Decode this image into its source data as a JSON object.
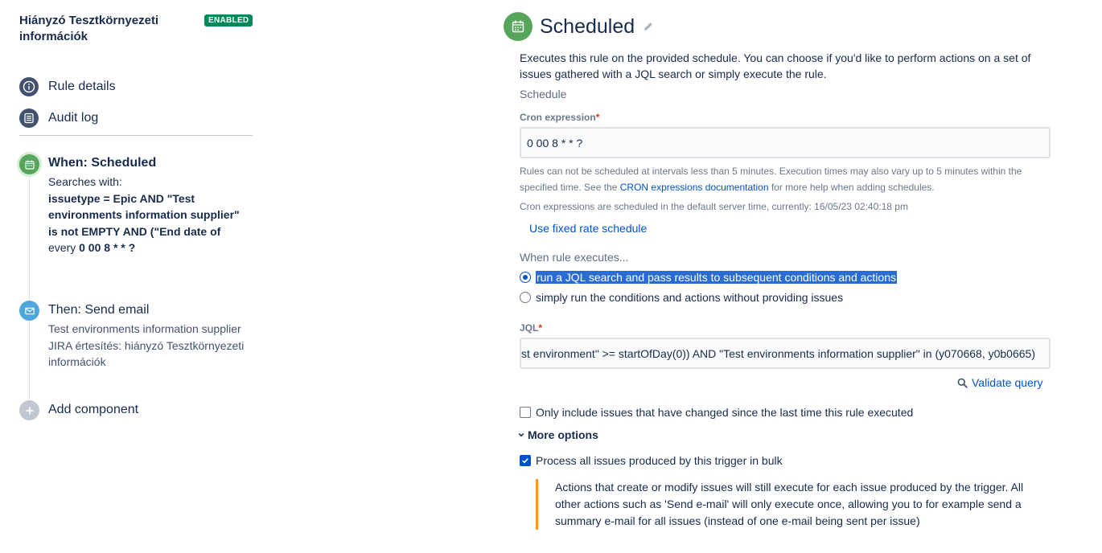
{
  "sidebar": {
    "rule_title": "Hiányzó Tesztkörnyezeti információk",
    "status_badge": "ENABLED",
    "nav": [
      {
        "label": "Rule details",
        "icon": "info-icon"
      },
      {
        "label": "Audit log",
        "icon": "list-icon"
      }
    ],
    "trigger": {
      "title": "When: Scheduled",
      "subtitle": "Searches with:",
      "jql_lines": [
        "issuetype = Epic AND \"Test",
        "environments information supplier\"",
        "is not EMPTY AND (\"End date of"
      ],
      "every_prefix": "every",
      "every_value": "0 00 8 * * ?",
      "icon": "calendar-icon"
    },
    "action": {
      "title": "Then: Send email",
      "lines": [
        "Test environments information supplier",
        "JIRA értesítés: hiányzó Tesztkörnyezeti",
        "információk"
      ],
      "icon": "mail-icon"
    },
    "add_component": {
      "label": "Add component",
      "icon": "plus-icon"
    }
  },
  "main": {
    "title": "Scheduled",
    "description": "Executes this rule on the provided schedule. You can choose if you'd like to perform actions on a set of issues gathered with a JQL search or simply execute the rule.",
    "schedule_label": "Schedule",
    "cron": {
      "label": "Cron expression",
      "required_mark": "*",
      "value": "0 00 8 * * ?",
      "help_part1": "Rules can not be scheduled at intervals less than 5 minutes. Execution times may also vary up to 5 minutes within the specified time. See the ",
      "help_link": "CRON expressions documentation",
      "help_part2": " for more help when adding schedules.",
      "server_time_note": "Cron expressions are scheduled in the default server time, currently: 16/05/23 02:40:18 pm"
    },
    "fixed_rate_link": "Use fixed rate schedule",
    "when_executes_label": "When rule executes...",
    "radio_options": [
      {
        "label": "run a JQL search and pass results to subsequent conditions and actions",
        "checked": true
      },
      {
        "label": "simply run the conditions and actions without providing issues",
        "checked": false
      }
    ],
    "jql": {
      "label": "JQL",
      "required_mark": "*",
      "value": "st environment\" >= startOfDay(0)) AND \"Test environments information supplier\" in (y070668, y0b0665)"
    },
    "validate_link": "Validate query",
    "only_changed": {
      "label": "Only include issues that have changed since the last time this rule executed",
      "checked": false
    },
    "more_options_label": "More options",
    "bulk": {
      "label": "Process all issues produced by this trigger in bulk",
      "checked": true
    },
    "bulk_info": "Actions that create or modify issues will still execute for each issue produced by the trigger. All other actions such as 'Send e-mail' will only execute once, allowing you to for example send a summary e-mail for all issues (instead of one e-mail being sent per issue)"
  },
  "colors": {
    "enabled_badge": "#00875a",
    "trigger_green": "#57a55a",
    "action_blue": "#4ea6dc",
    "link_blue": "#0052cc",
    "info_border_orange": "#ff991f",
    "selection_blue": "#2b6cd0"
  }
}
